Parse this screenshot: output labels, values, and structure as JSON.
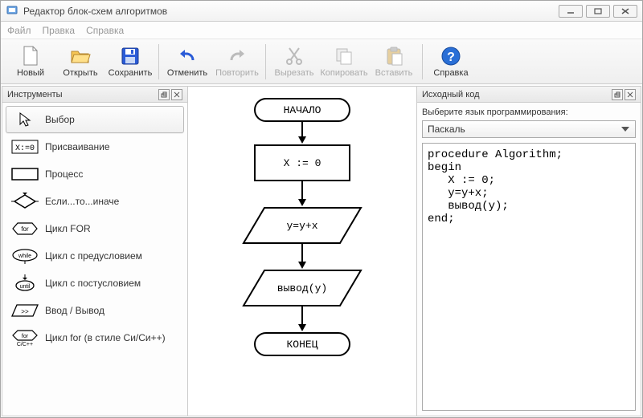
{
  "window": {
    "title": "Редактор блок-схем алгоритмов"
  },
  "menu": {
    "file": "Файл",
    "edit": "Правка",
    "help": "Справка"
  },
  "toolbar": {
    "new": "Новый",
    "open": "Открыть",
    "save": "Сохранить",
    "undo": "Отменить",
    "redo": "Повторить",
    "cut": "Вырезать",
    "copy": "Копировать",
    "paste": "Вставить",
    "help": "Справка"
  },
  "panels": {
    "tools_title": "Инструменты",
    "code_title": "Исходный код"
  },
  "tools": [
    {
      "label": "Выбор"
    },
    {
      "label": "Присваивание"
    },
    {
      "label": "Процесс"
    },
    {
      "label": "Если...то...иначе"
    },
    {
      "label": "Цикл FOR"
    },
    {
      "label": "Цикл с предусловием"
    },
    {
      "label": "Цикл c постусловием"
    },
    {
      "label": "Ввод / Вывод"
    },
    {
      "label": "Цикл for (в стиле Си/Си++)"
    }
  ],
  "code": {
    "select_label": "Выберите язык программирования:",
    "language": "Паскаль",
    "source": "procedure Algorithm;\nbegin\n   X := 0;\n   y=y+x;\n   вывод(y);\nend;"
  },
  "flowchart": {
    "start": "НАЧАЛО",
    "n1": "X := 0",
    "n2": "y=y+x",
    "n3": "вывод(y)",
    "end": "КОНЕЦ"
  }
}
